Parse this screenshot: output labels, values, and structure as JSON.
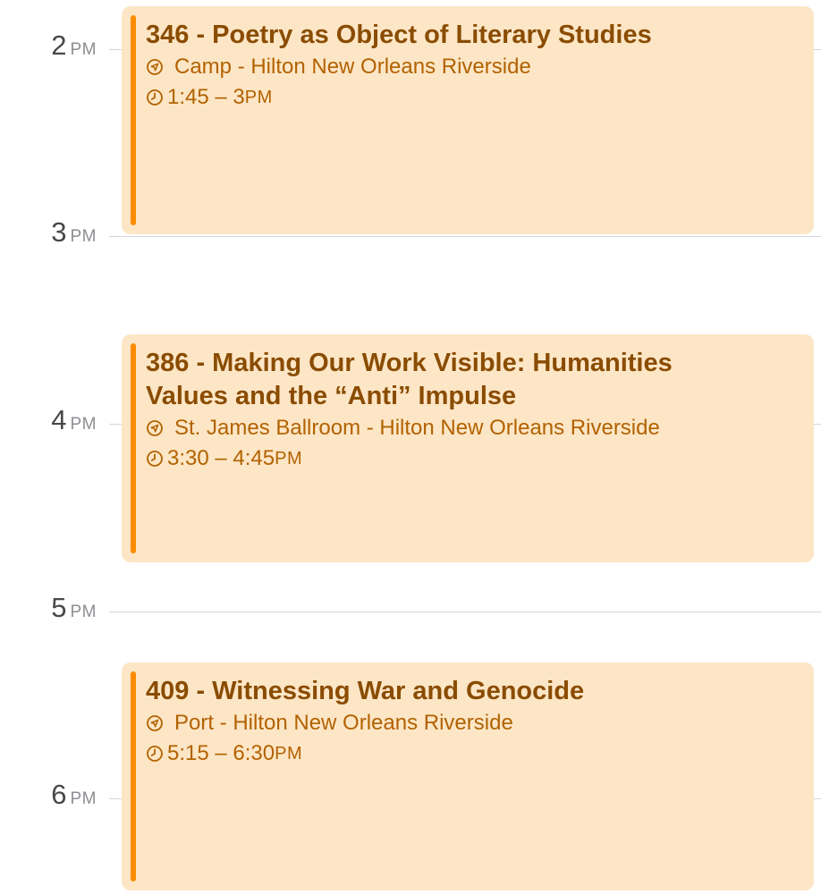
{
  "timeline": {
    "hours": [
      {
        "num": "2",
        "ampm": "PM"
      },
      {
        "num": "3",
        "ampm": "PM"
      },
      {
        "num": "4",
        "ampm": "PM"
      },
      {
        "num": "5",
        "ampm": "PM"
      },
      {
        "num": "6",
        "ampm": "PM"
      }
    ]
  },
  "events": [
    {
      "title": "346 - Poetry as Object of Literary Studies",
      "location": "Camp - Hilton New Orleans Riverside",
      "time_range": "1:45 – 3",
      "time_suffix": "PM"
    },
    {
      "title": "386 - Making Our Work Visible: Humanities Values and the “Anti” Impulse",
      "location": "St. James Ballroom - Hilton New Orleans Riverside",
      "time_range": "3:30 – 4:45",
      "time_suffix": "PM"
    },
    {
      "title": "409 - Witnessing War and Genocide",
      "location": "Port - Hilton New Orleans Riverside",
      "time_range": "5:15 – 6:30",
      "time_suffix": "PM"
    }
  ],
  "colors": {
    "event_background": "#fde6c6",
    "event_accent": "#fb8c00",
    "event_title": "#8a4c00",
    "event_meta": "#b26200",
    "hour_line": "#d6d6da"
  },
  "icons": {
    "location": "location-arrow-icon",
    "time": "clock-icon"
  }
}
